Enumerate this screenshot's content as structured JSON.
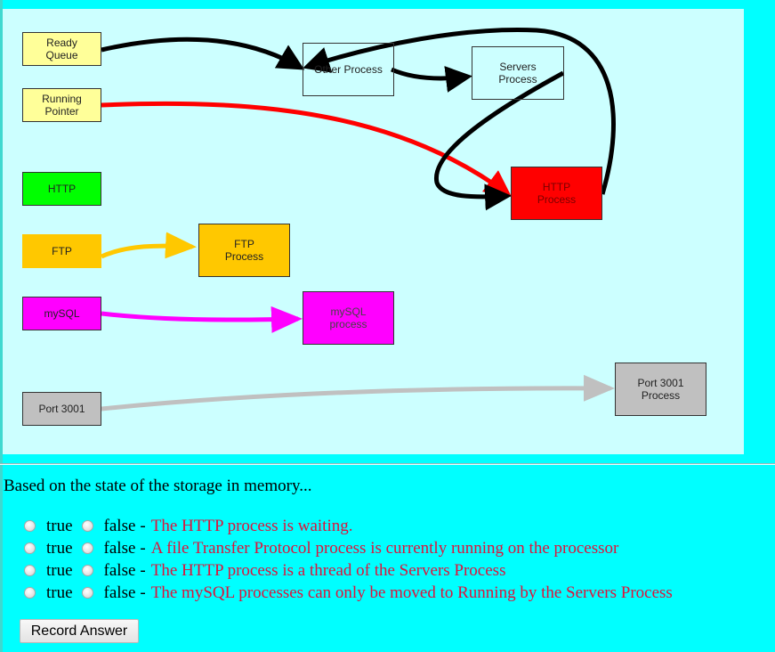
{
  "diagram": {
    "nodes": {
      "ready_queue": "Ready\nQueue",
      "running_pointer": "Running\nPointer",
      "http": "HTTP",
      "ftp": "FTP",
      "mysql": "mySQL",
      "port3001": "Port 3001",
      "other_process": "Other Process",
      "servers_process": "Servers\nProcess",
      "http_process": "HTTP\nProcess",
      "ftp_process": "FTP\nProcess",
      "mysql_process": "mySQL\nprocess",
      "port3001_process": "Port 3001\nProcess"
    },
    "colors": {
      "background": "#ccffff",
      "queue_yellow": "#ffff99",
      "http_green": "#00ff00",
      "ftp_orange": "#ffc800",
      "mysql_magenta": "#ff00ff",
      "port_gray": "#c0c0c0",
      "http_process_red": "#ff0000",
      "arrow_black": "#000000",
      "arrow_red": "#ff0000",
      "arrow_orange": "#ffc800",
      "arrow_magenta": "#ff00ff",
      "arrow_gray": "#c0c0c0"
    },
    "edges": [
      {
        "from": "Ready Queue",
        "to": "Other Process",
        "color": "black"
      },
      {
        "from": "Running Pointer",
        "to": "HTTP Process",
        "color": "red"
      },
      {
        "from": "Other Process",
        "to": "Servers Process",
        "color": "black"
      },
      {
        "from": "Servers Process",
        "to": "HTTP Process",
        "color": "black"
      },
      {
        "from": "HTTP Process",
        "to": "Other Process",
        "color": "black"
      },
      {
        "from": "FTP",
        "to": "FTP Process",
        "color": "orange"
      },
      {
        "from": "mySQL",
        "to": "mySQL process",
        "color": "magenta"
      },
      {
        "from": "Port 3001",
        "to": "Port 3001 Process",
        "color": "gray"
      }
    ]
  },
  "quiz": {
    "prompt": "Based on the state of the storage in memory...",
    "true_label": "true",
    "false_label": "false",
    "separator": "-",
    "questions": [
      {
        "statement": "The HTTP process is waiting.",
        "selected": null
      },
      {
        "statement": "A file Transfer Protocol process is currently running on the processor",
        "selected": null
      },
      {
        "statement": "The HTTP process is a thread of the Servers Process",
        "selected": null
      },
      {
        "statement": "The mySQL processes can only be moved to Running by the Servers Process",
        "selected": null
      }
    ],
    "submit_label": "Record Answer"
  }
}
